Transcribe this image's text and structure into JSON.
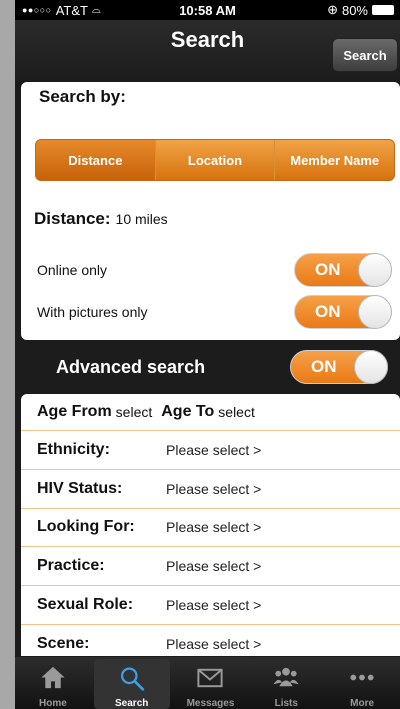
{
  "status_bar": {
    "carrier": "AT&T",
    "signal": "●●○○○",
    "wifi": "⌓",
    "time": "10:58 AM",
    "battery": "80%",
    "alarm_icon": "⊕"
  },
  "nav": {
    "title": "Search",
    "search_button": "Search"
  },
  "search_by": {
    "label": "Search by:",
    "options": [
      "Distance",
      "Location",
      "Member Name"
    ],
    "selected": "Distance"
  },
  "distance": {
    "label": "Distance:",
    "value": "10 miles"
  },
  "filters": [
    {
      "label": "Online only",
      "state": "ON"
    },
    {
      "label": "With pictures only",
      "state": "ON"
    }
  ],
  "advanced": {
    "label": "Advanced search",
    "state": "ON"
  },
  "age": {
    "from_label": "Age From",
    "from_value": "select",
    "to_label": "Age To",
    "to_value": "select"
  },
  "criteria": [
    {
      "label": "Ethnicity:",
      "value": "Please select >"
    },
    {
      "label": "HIV Status:",
      "value": "Please select >"
    },
    {
      "label": "Looking For:",
      "value": "Please select >"
    },
    {
      "label": "Practice:",
      "value": "Please select >"
    },
    {
      "label": "Sexual Role:",
      "value": "Please select >"
    },
    {
      "label": "Scene:",
      "value": "Please select >"
    }
  ],
  "tabs": [
    {
      "label": "Home",
      "icon": "house-icon"
    },
    {
      "label": "Search",
      "icon": "magnifier-icon",
      "active": true
    },
    {
      "label": "Messages",
      "icon": "envelope-icon"
    },
    {
      "label": "Lists",
      "icon": "people-icon"
    },
    {
      "label": "More",
      "icon": "ellipsis-icon"
    }
  ],
  "colors": {
    "accent": "#EA7A16",
    "row_divider": "#F5C48D",
    "background": "#1C1C1C"
  }
}
